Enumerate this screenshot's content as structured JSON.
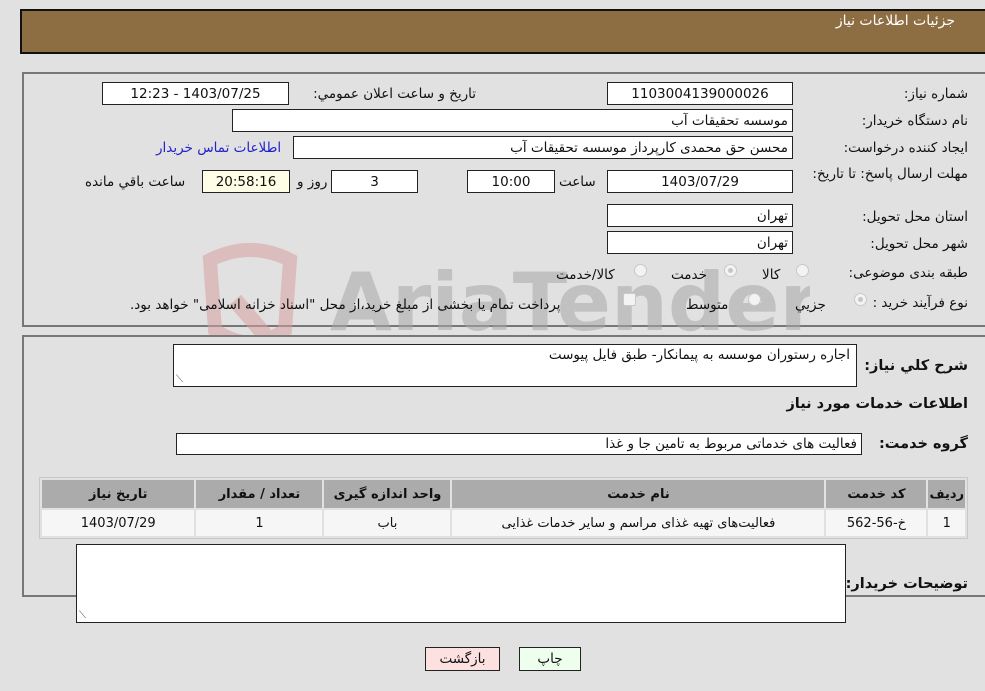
{
  "header": {
    "title": "جزئیات اطلاعات نیاز"
  },
  "form": {
    "need_number": {
      "label": "شماره نیاز:",
      "value": "1103004139000026"
    },
    "announce_datetime": {
      "label": "تاریخ و ساعت اعلان عمومي:",
      "value": "1403/07/25 - 12:23"
    },
    "buyer_org": {
      "label": "نام دستگاه خریدار:",
      "value": "موسسه تحقیقات آب"
    },
    "requester": {
      "label": "ایجاد کننده درخواست:",
      "value": "محسن حق محمدی کارپرداز موسسه تحقیقات آب"
    },
    "buyer_contact_link": "اطلاعات تماس خریدار",
    "deadline": {
      "label": "مهلت ارسال پاسخ: تا تاریخ:",
      "date": "1403/07/29",
      "time_label": "ساعت",
      "time": "10:00",
      "days": "3",
      "days_label": "روز و",
      "remaining": "20:58:16",
      "remaining_label": "ساعت باقي مانده"
    },
    "province": {
      "label": "استان محل تحویل:",
      "value": "تهران"
    },
    "city": {
      "label": "شهر محل تحویل:",
      "value": "تهران"
    },
    "category": {
      "label": "طبقه بندی موضوعی:",
      "options": [
        "کالا",
        "خدمت",
        "کالا/خدمت"
      ],
      "selected": "خدمت"
    },
    "purchase_type": {
      "label": "نوع فرآیند خرید :",
      "options": [
        "جزيي",
        "متوسط"
      ],
      "selected": "جزيي",
      "treasury_note": "پرداخت تمام یا بخشی از مبلغ خرید،از محل \"اسناد خزانه اسلامی\" خواهد بود."
    }
  },
  "details": {
    "description_label": "شرح کلي نیاز:",
    "description_value": "اجاره رستوران موسسه به پیمانکار- طبق فایل پیوست",
    "services_heading": "اطلاعات خدمات مورد نیاز",
    "service_group_label": "گروه خدمت:",
    "service_group_value": "فعالیت های خدماتی مربوط به تامین جا و غذا",
    "table": {
      "headers": [
        "ردیف",
        "کد خدمت",
        "نام خدمت",
        "واحد اندازه گیری",
        "تعداد / مقدار",
        "تاریخ نیاز"
      ],
      "rows": [
        [
          "1",
          "خ-56-562",
          "فعالیت‌های تهیه غذای مراسم و سایر خدمات غذایی",
          "باب",
          "1",
          "1403/07/29"
        ]
      ]
    },
    "buyer_notes_label": "توضیحات خریدار:",
    "buyer_notes_value": ""
  },
  "buttons": {
    "print": "چاپ",
    "back": "بازگشت"
  },
  "watermark": {
    "text": "AriaTender.neT",
    "colors": {
      "shield": "#d9a0a0",
      "text": "#9a9a9a"
    }
  }
}
